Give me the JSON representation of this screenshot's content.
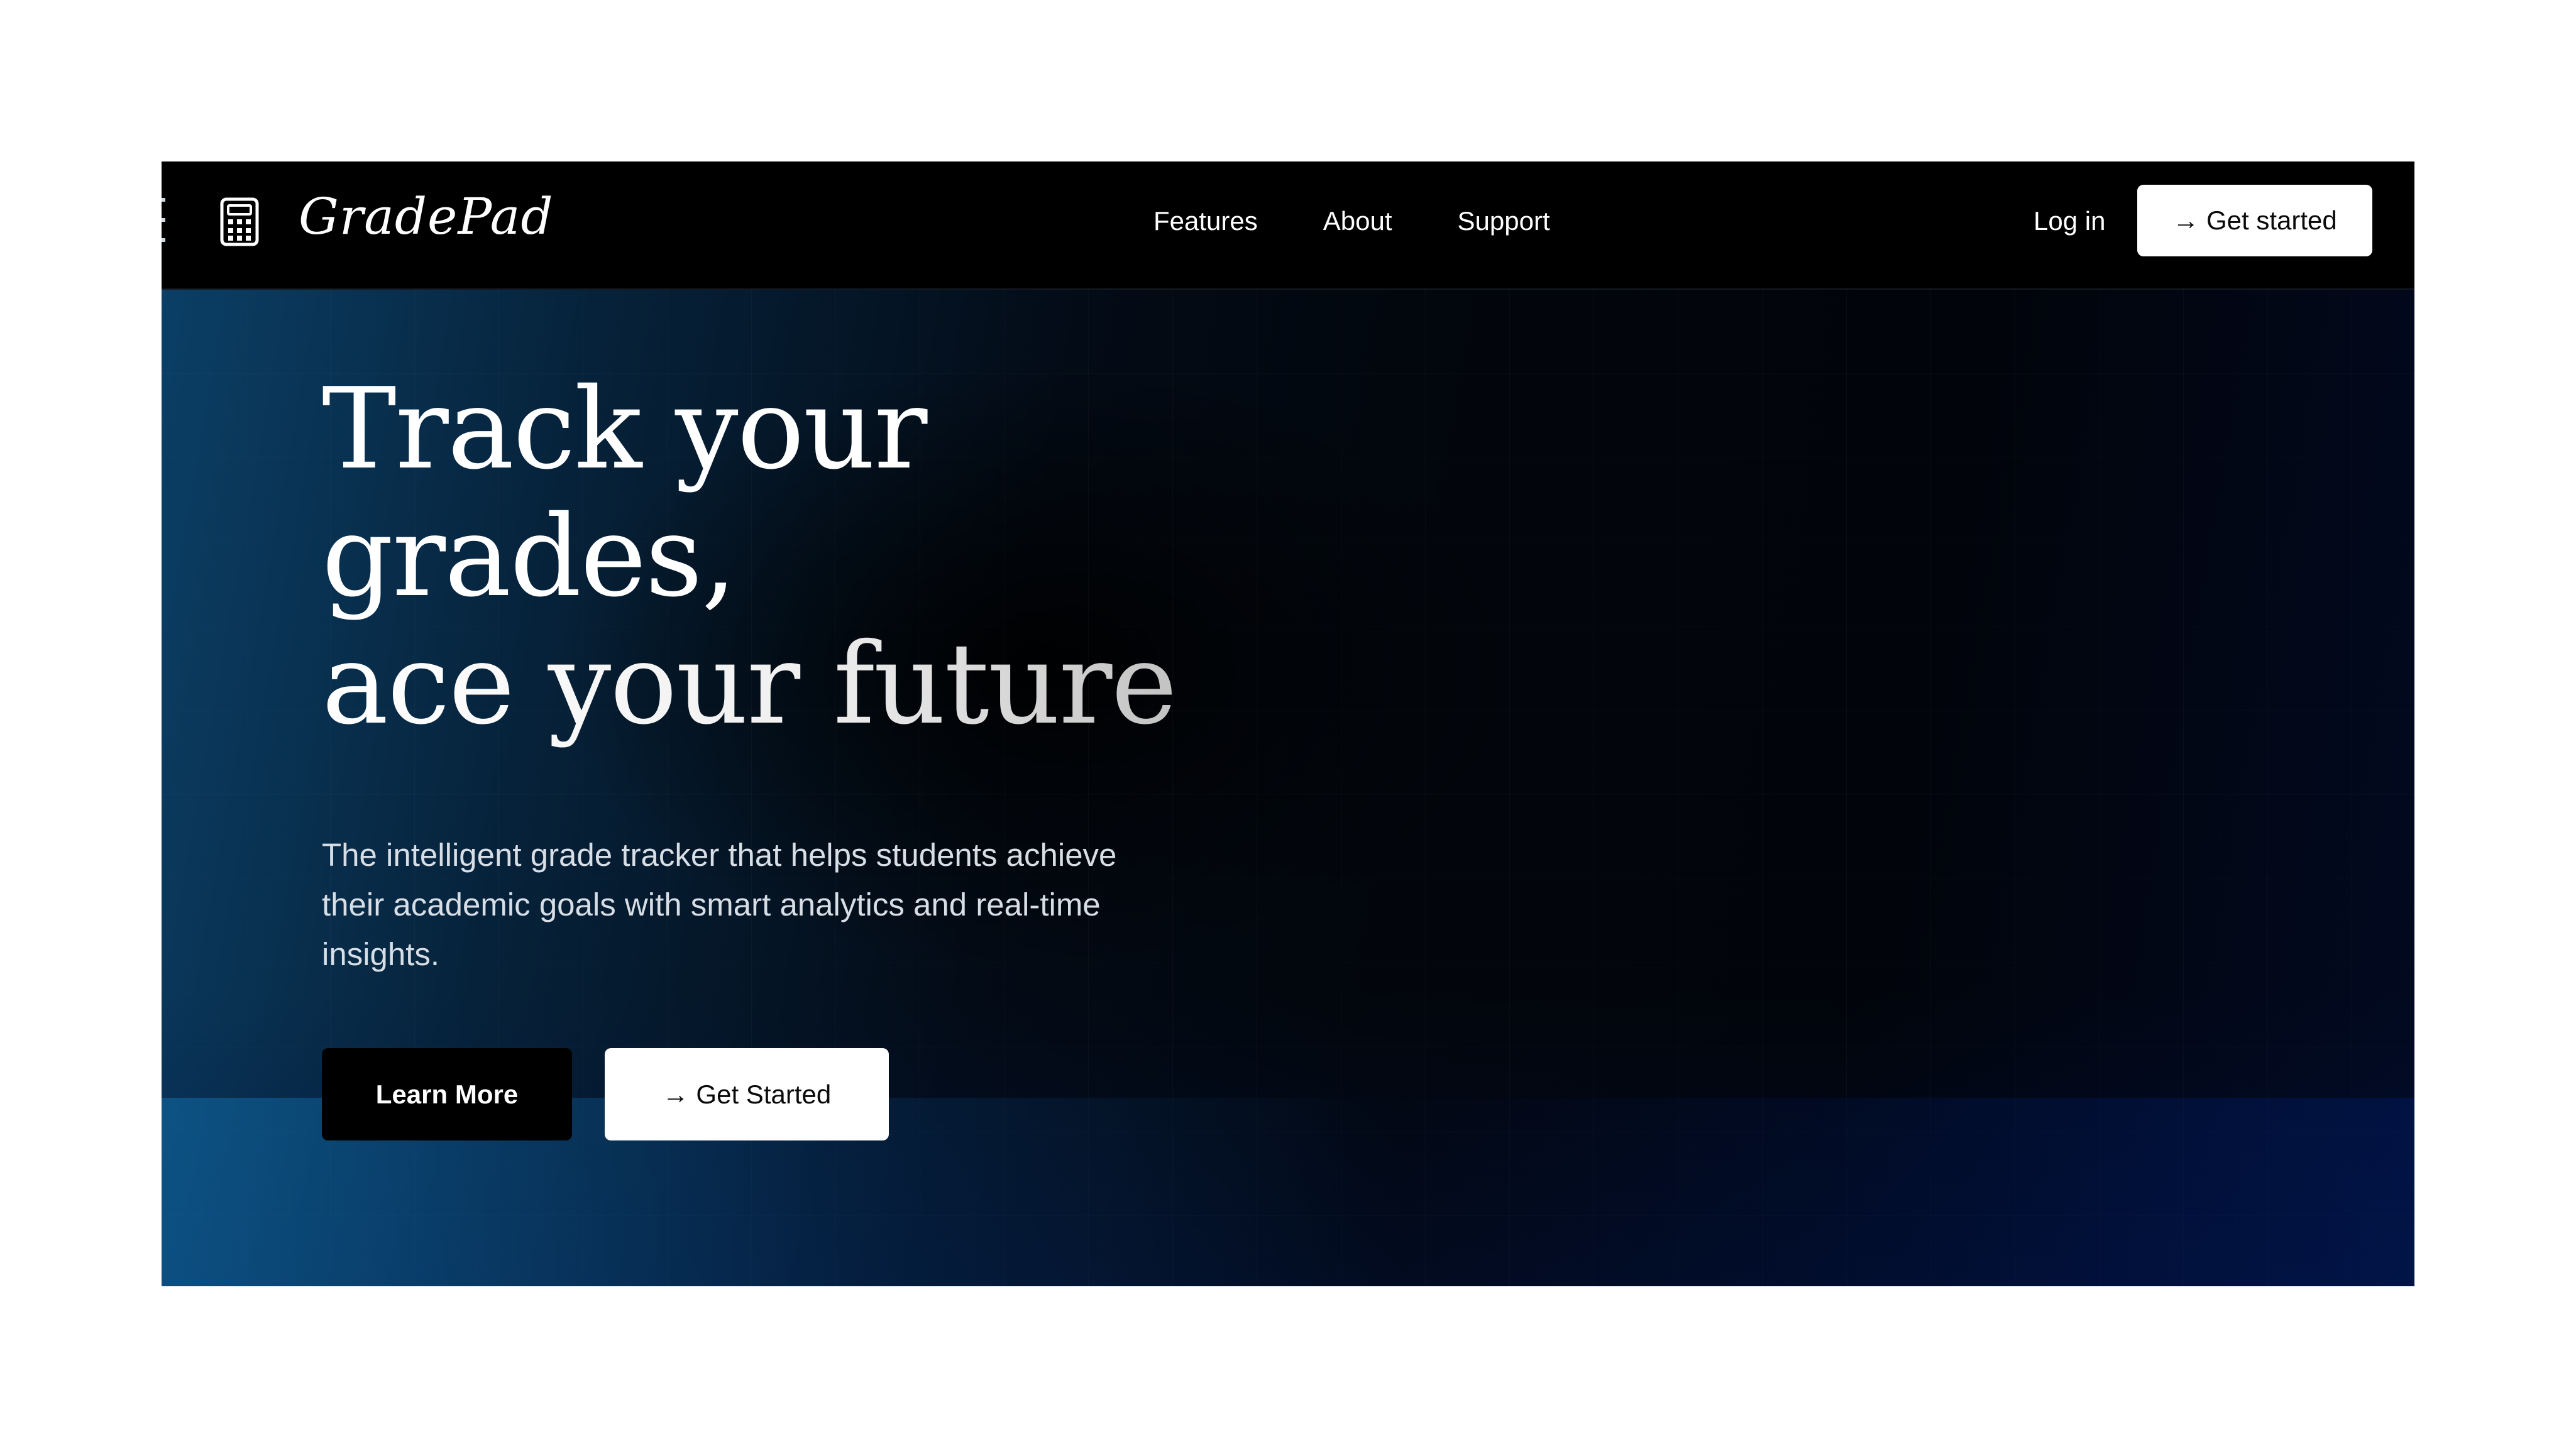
{
  "brand": {
    "name": "GradePad",
    "icon": "calculator-icon"
  },
  "nav": {
    "links": [
      "Features",
      "About",
      "Support"
    ],
    "login_label": "Log in",
    "cta_label": "→ Get started"
  },
  "hero": {
    "headline_line1": "Track your",
    "headline_line2": "grades,",
    "headline_line3": "ace your future",
    "subtext": "The intelligent grade tracker that helps students achieve their academic goals with smart analytics and real-time insights.",
    "primary_button": "Learn More",
    "secondary_button": "→ Get Started"
  },
  "colors": {
    "background": "#000000",
    "accent_blue": "#0b3f66",
    "button_light": "#ffffff"
  }
}
